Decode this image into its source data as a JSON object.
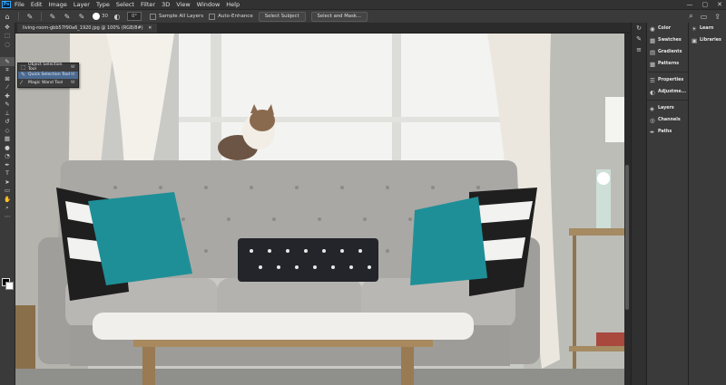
{
  "app": {
    "logo": "Ps"
  },
  "menu": [
    "File",
    "Edit",
    "Image",
    "Layer",
    "Type",
    "Select",
    "Filter",
    "3D",
    "View",
    "Window",
    "Help"
  ],
  "window_controls": {
    "minimize": "—",
    "maximize": "▢",
    "close": "✕"
  },
  "options": {
    "brush_size": "30",
    "angle": "0°",
    "sample_all_layers": "Sample All Layers",
    "auto_enhance": "Auto-Enhance",
    "select_subject": "Select Subject",
    "select_and_mask": "Select and Mask..."
  },
  "document": {
    "tab_title": "living-room-gbb57f90a6_1920.jpg @ 100% (RGB/8#)",
    "close": "✕"
  },
  "tool_flyout": [
    {
      "label": "Object Selection Tool",
      "key": "W",
      "icon": "object-selection-icon"
    },
    {
      "label": "Quick Selection Tool",
      "key": "W",
      "icon": "quick-selection-icon"
    },
    {
      "label": "Magic Wand Tool",
      "key": "W",
      "icon": "magic-wand-icon"
    }
  ],
  "panels": [
    {
      "label": "Color",
      "icon": "color-icon"
    },
    {
      "label": "Swatches",
      "icon": "swatches-icon"
    },
    {
      "label": "Gradients",
      "icon": "gradients-icon"
    },
    {
      "label": "Patterns",
      "icon": "patterns-icon"
    },
    {
      "label": "Properties",
      "icon": "properties-icon"
    },
    {
      "label": "Adjustme...",
      "icon": "adjustments-icon"
    },
    {
      "label": "Layers",
      "icon": "layers-icon"
    },
    {
      "label": "Channels",
      "icon": "channels-icon"
    },
    {
      "label": "Paths",
      "icon": "paths-icon"
    }
  ],
  "panels_right": [
    {
      "label": "Learn",
      "icon": "learn-icon"
    },
    {
      "label": "Libraries",
      "icon": "libraries-icon"
    }
  ],
  "colors": {
    "foreground": "#000000",
    "background": "#ffffff",
    "selection": "#4b6a93"
  }
}
